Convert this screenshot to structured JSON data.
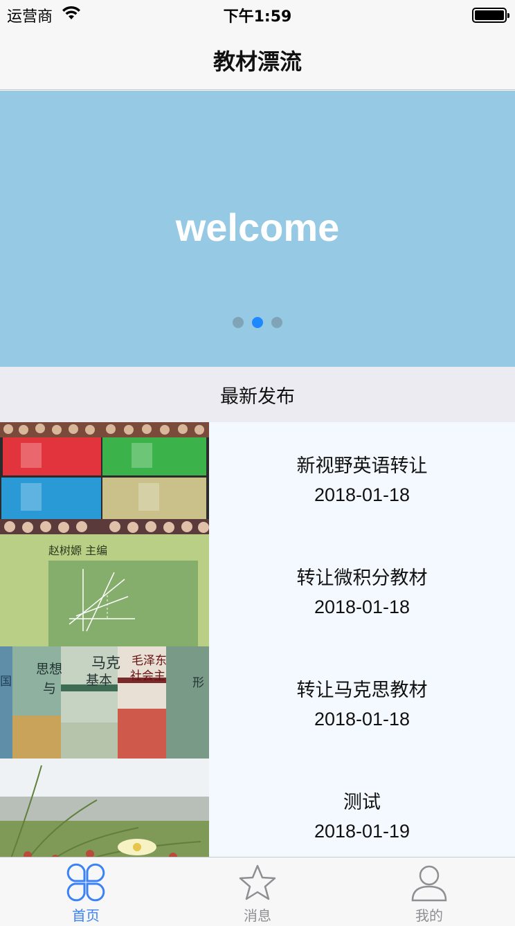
{
  "status_bar": {
    "carrier": "运营商",
    "time": "下午1:59",
    "battery_level": 1.0
  },
  "nav": {
    "title": "教材漂流"
  },
  "banner": {
    "text": "welcome",
    "page_count": 3,
    "active_page": 1,
    "background_color": "#96c9e3",
    "active_dot_color": "#1e88ff"
  },
  "section": {
    "title": "最新发布"
  },
  "listings": [
    {
      "title": "新视野英语转让",
      "date": "2018-01-18",
      "thumbnail": "film-books-collage-image"
    },
    {
      "title": "转让微积分教材",
      "date": "2018-01-18",
      "thumbnail": "calculus-book-cover-image"
    },
    {
      "title": "转让马克思教材",
      "date": "2018-01-18",
      "thumbnail": "marxism-books-image"
    },
    {
      "title": "测试",
      "date": "2018-01-19",
      "thumbnail": "beach-grass-photo"
    }
  ],
  "thumb_text": {
    "math_editor": "赵树嫄 主编",
    "spine_1": "马克",
    "spine_2": "基本",
    "spine_3": "毛泽东",
    "spine_4": "社会主",
    "spine_5": "思想",
    "spine_6": "与",
    "spine_7": "国",
    "spine_8": "形"
  },
  "tabs": [
    {
      "label": "首页",
      "icon": "clover-icon",
      "active": true
    },
    {
      "label": "消息",
      "icon": "star-icon",
      "active": false
    },
    {
      "label": "我的",
      "icon": "person-icon",
      "active": false
    }
  ],
  "colors": {
    "accent": "#3b82f6",
    "list_background": "#f3f9fe",
    "section_background": "#ebebf1"
  }
}
